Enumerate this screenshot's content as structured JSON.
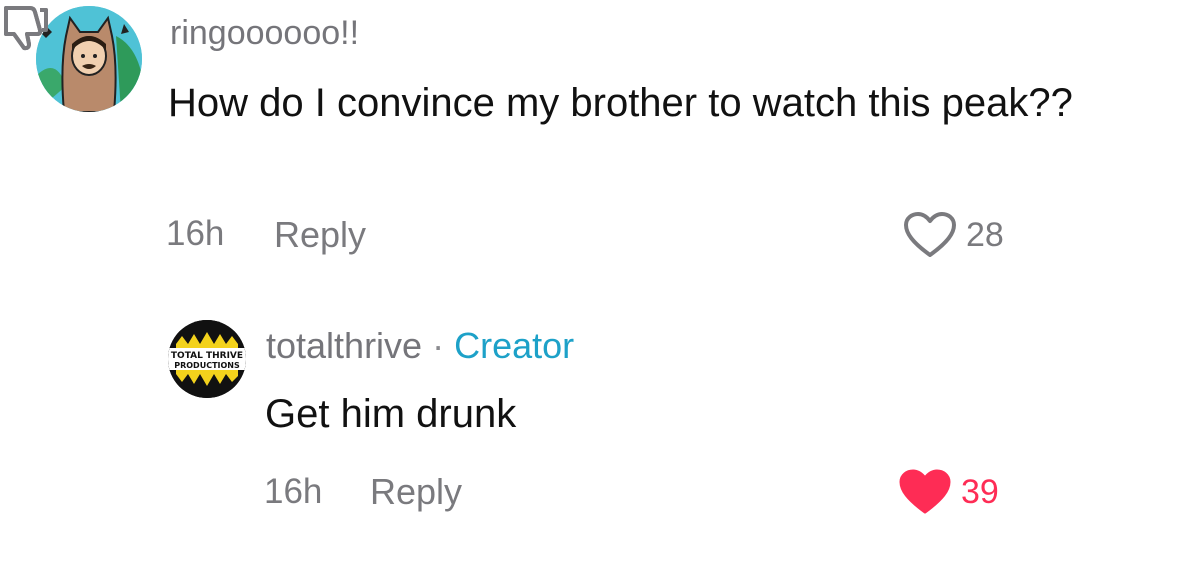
{
  "comments": [
    {
      "username": "ringoooooo!!",
      "text": "How do I convince my brother to watch this peak??",
      "time": "16h",
      "reply_label": "Reply",
      "likes": "28",
      "liked": false,
      "avatar_icon": "cartoon-cat-hood-avatar"
    },
    {
      "username": "totalthrive",
      "separator": "·",
      "badge": "Creator",
      "text": "Get him drunk",
      "time": "16h",
      "reply_label": "Reply",
      "likes": "39",
      "liked": true,
      "avatar_icon": "total-thrive-productions-logo",
      "avatar_text": "TOTAL THRIVE PRODUCTIONS"
    }
  ],
  "colors": {
    "username": "#75757a",
    "creator_badge": "#1da1c8",
    "liked_heart": "#fe2c55"
  }
}
